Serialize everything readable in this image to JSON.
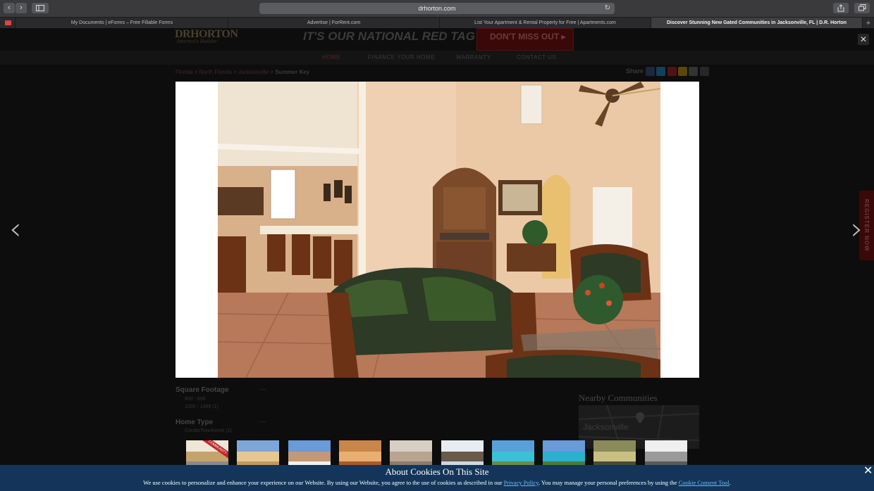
{
  "browser": {
    "url": "drhorton.com",
    "tabs": [
      {
        "title": "My Documents | eForms – Free Fillable Forms",
        "active": false
      },
      {
        "title": "Advertise | ForRent.com",
        "active": false
      },
      {
        "title": "List Your Apartment & Rental Property for Free | Apartments.com",
        "active": false
      },
      {
        "title": "Discover Stunning New Gated Communities in Jacksonville, FL | D.R. Horton",
        "active": true
      }
    ],
    "back_glyph": "‹",
    "forward_glyph": "›",
    "reload_glyph": "↻",
    "new_tab_glyph": "+"
  },
  "site": {
    "logo": "DRHORTON",
    "logo_tagline": "America's Builder",
    "banner_text": "IT'S OUR NATIONAL RED TAG EVENT!",
    "banner_button": "DON'T MISS OUT ▸",
    "nav": [
      "HOME",
      "FINANCE YOUR HOME",
      "WARRANTY",
      "CONTACT US"
    ],
    "breadcrumb": {
      "links": [
        "Florida",
        "North Florida",
        "Jacksonville"
      ],
      "separator": " > ",
      "current": "Summer Key"
    },
    "share_label": "Share",
    "share_colors": [
      "#3b5998",
      "#1da1f2",
      "#cb2027",
      "#f4b400",
      "#7a7a7a",
      "#5a5a5a"
    ],
    "sidebar": {
      "sq_heading": "Square Footage",
      "sq_options": [
        "800 - 899",
        "1000 - 1499 (1)"
      ],
      "type_heading": "Home Type",
      "type_options": [
        "Condo/Townhome (1)"
      ],
      "toggle_glyph": "—"
    },
    "nearby_heading": "Nearby Communities",
    "map_label": "Jacksonville",
    "side_tab_label": "REGISTER NOW"
  },
  "lightbox": {
    "prev_glyph": "‹",
    "next_glyph": "›",
    "close_glyph": "✕",
    "thumbnail_count": 10,
    "thumb_badge": "COMMUNITY"
  },
  "cookie_banner": {
    "title": "About Cookies On This Site",
    "text_before": "We use cookies to personalize and enhance your experience on our Website. By using our Website, you agree to the use of cookies as described in our ",
    "privacy_link": "Privacy Policy",
    "text_middle": ". You may manage your personal preferences by using the ",
    "consent_link": "Cookie Consent Tool",
    "text_after": ".",
    "close_glyph": "✕"
  }
}
